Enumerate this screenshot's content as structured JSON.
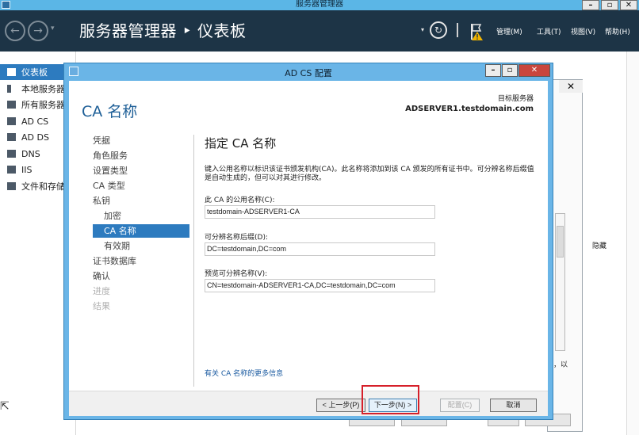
{
  "server_manager": {
    "window_title": "服务器管理器",
    "breadcrumb": "服务器管理器 ‣ 仪表板",
    "menus": [
      "管理(M)",
      "工具(T)",
      "视图(V)",
      "帮助(H)"
    ],
    "nav_items": [
      "仪表板",
      "本地服务器",
      "所有服务器",
      "AD CS",
      "AD DS",
      "DNS",
      "IIS",
      "文件和存储"
    ],
    "bg_text": {
      "hide": "隐藏",
      "tail": "，以"
    }
  },
  "dialog": {
    "title": "AD CS 配置",
    "page_title": "CA 名称",
    "destination_label": "目标服务器",
    "destination_server": "ADSERVER1.testdomain.com",
    "steps": [
      {
        "label": "凭据",
        "state": "normal"
      },
      {
        "label": "角色服务",
        "state": "normal"
      },
      {
        "label": "设置类型",
        "state": "normal"
      },
      {
        "label": "CA 类型",
        "state": "normal"
      },
      {
        "label": "私钥",
        "state": "normal"
      },
      {
        "label": "加密",
        "state": "sub"
      },
      {
        "label": "CA 名称",
        "state": "selected"
      },
      {
        "label": "有效期",
        "state": "sub"
      },
      {
        "label": "证书数据库",
        "state": "normal"
      },
      {
        "label": "确认",
        "state": "normal"
      },
      {
        "label": "进度",
        "state": "disabled"
      },
      {
        "label": "结果",
        "state": "disabled"
      }
    ],
    "section_title": "指定 CA 名称",
    "description": "键入公用名称以标识该证书颁发机构(CA)。此名称将添加到该 CA 颁发的所有证书中。可分辨名称后缀值是自动生成的，但可以对其进行修改。",
    "common_name_label": "此 CA 的公用名称(C):",
    "common_name_value": "testdomain-ADSERVER1-CA",
    "dn_suffix_label": "可分辨名称后缀(D):",
    "dn_suffix_value": "DC=testdomain,DC=com",
    "preview_label": "预览可分辨名称(V):",
    "preview_value": "CN=testdomain-ADSERVER1-CA,DC=testdomain,DC=com",
    "more_link": "有关 CA 名称的更多信息",
    "buttons": {
      "back": "< 上一步(P)",
      "next": "下一步(N) >",
      "configure": "配置(C)",
      "cancel": "取消"
    }
  },
  "colors": {
    "accent": "#2d7bbf",
    "dialog_frame": "#6ab5e7",
    "header_bg": "#1d3446",
    "highlight": "#d6202a"
  }
}
